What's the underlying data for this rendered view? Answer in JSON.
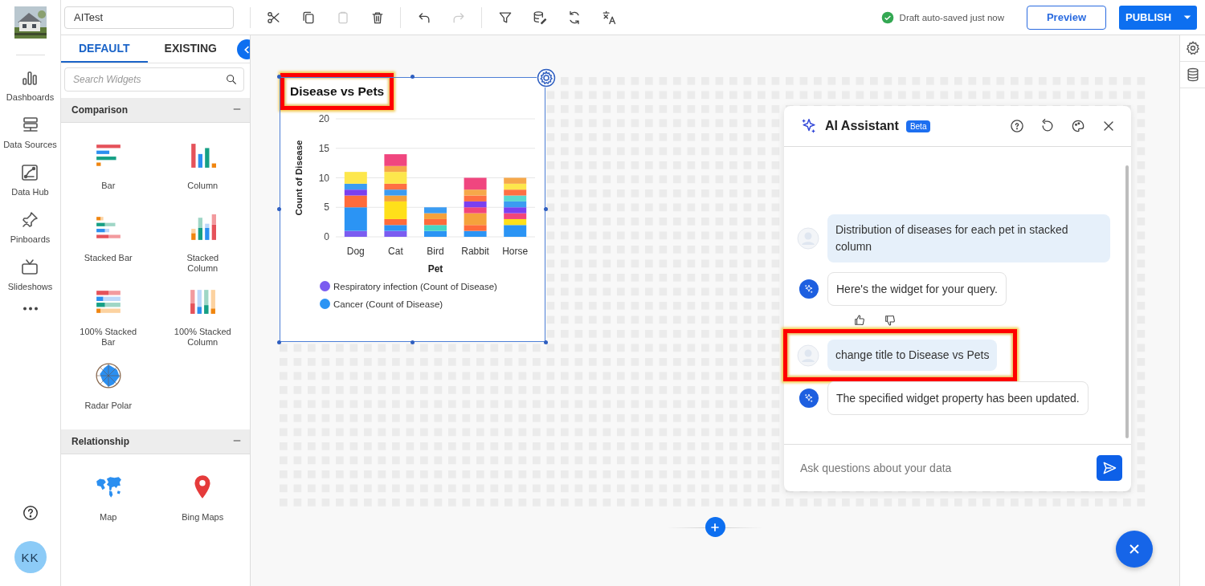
{
  "nav": {
    "items": [
      {
        "label": "Dashboards",
        "kind": "dashboards"
      },
      {
        "label": "Data Sources",
        "kind": "sources"
      },
      {
        "label": "Data Hub",
        "kind": "hub"
      },
      {
        "label": "Pinboards",
        "kind": "pin"
      },
      {
        "label": "Slideshows",
        "kind": "slides"
      },
      {
        "kind": "more"
      }
    ],
    "user": {
      "initials": "KK"
    }
  },
  "toolbar": {
    "title_field": {
      "value": "AITest"
    },
    "tools": [
      {
        "kind": "cut",
        "disabled": false
      },
      {
        "kind": "copy",
        "disabled": false
      },
      {
        "kind": "paste",
        "disabled": true
      },
      {
        "kind": "delete",
        "disabled": false
      },
      {
        "kind": "undo",
        "disabled": false
      },
      {
        "kind": "redo",
        "disabled": true
      },
      {
        "kind": "filter",
        "disabled": false
      },
      {
        "kind": "dataedit",
        "disabled": false
      },
      {
        "kind": "refresh",
        "disabled": false
      },
      {
        "kind": "translate",
        "disabled": false
      }
    ],
    "status": "Draft auto-saved just now",
    "preview": "Preview",
    "publish": "PUBLISH"
  },
  "widget_panel": {
    "tabs": [
      {
        "label": "DEFAULT",
        "selected": true
      },
      {
        "label": "EXISTING",
        "selected": false
      }
    ],
    "search": {
      "placeholder": "Search Widgets"
    },
    "groups": [
      {
        "title": "Comparison",
        "expanded": true,
        "items": [
          {
            "label": "Bar",
            "kind": "bar"
          },
          {
            "label": "Column",
            "kind": "column"
          },
          {
            "label": "Stacked Bar",
            "kind": "stackedbar"
          },
          {
            "label": "Stacked Column",
            "kind": "stackedcolumn"
          },
          {
            "label": "100% Stacked Bar",
            "kind": "bar100"
          },
          {
            "label": "100% Stacked Column",
            "kind": "column100"
          },
          {
            "label": "Radar Polar",
            "kind": "radar"
          }
        ]
      },
      {
        "title": "Relationship",
        "expanded": true,
        "items": [
          {
            "label": "Map",
            "kind": "map"
          },
          {
            "label": "Bing Maps",
            "kind": "pinmap"
          }
        ]
      }
    ]
  },
  "widget": {
    "title": "Disease vs Pets",
    "title_highlighted": true,
    "selected": true,
    "chart_data": {
      "type": "bar",
      "stacked": true,
      "grid": true,
      "xlabel": "Pet",
      "ylabel": "Count of Disease",
      "categories": [
        "Dog",
        "Cat",
        "Bird",
        "Rabbit",
        "Horse"
      ],
      "yticks": [
        0,
        5,
        10,
        15,
        20
      ],
      "ylim": [
        0,
        20
      ],
      "series": [
        {
          "name": "Respiratory infection (Count of Disease)",
          "color": "#7b5cf0",
          "values": [
            1,
            1,
            null,
            null,
            null
          ]
        },
        {
          "name": "Cancer (Count of Disease)",
          "color": "#2b94f4",
          "values": [
            4,
            1,
            1,
            1,
            2
          ]
        },
        {
          "color": "#46d6c4",
          "values": [
            null,
            null,
            1,
            null,
            null
          ]
        },
        {
          "color": "#ff6b3b",
          "values": [
            2,
            1,
            1,
            1,
            null
          ]
        },
        {
          "color": "#ffe01a",
          "values": [
            null,
            3,
            null,
            null,
            1
          ]
        },
        {
          "color": "#f5a23c",
          "values": [
            null,
            1,
            1,
            2,
            null
          ]
        },
        {
          "color": "#f2457a",
          "values": [
            null,
            null,
            null,
            1,
            1
          ]
        },
        {
          "color": "#7b3ff0",
          "values": [
            1,
            null,
            null,
            1,
            1
          ]
        },
        {
          "color": "#3b9cf2",
          "values": [
            1,
            1,
            1,
            null,
            1
          ]
        },
        {
          "color": "#5ad9d0",
          "values": [
            null,
            null,
            null,
            null,
            1
          ]
        },
        {
          "color": "#ff7043",
          "values": [
            null,
            1,
            null,
            1,
            1
          ]
        },
        {
          "color": "#fde74c",
          "values": [
            2,
            2,
            null,
            null,
            1
          ]
        },
        {
          "color": "#f6a84a",
          "values": [
            null,
            1,
            null,
            1,
            1
          ]
        },
        {
          "color": "#f0467f",
          "values": [
            null,
            2,
            null,
            2,
            null
          ]
        }
      ]
    }
  },
  "assistant": {
    "title": "AI Assistant",
    "badge": "Beta",
    "messages": [
      {
        "kind": "user",
        "text": "Distribution of diseases for each pet in stacked column",
        "highlighted": false,
        "feedback": false
      },
      {
        "kind": "assistant",
        "text": "Here's the widget for your query.",
        "highlighted": false,
        "feedback": true
      },
      {
        "kind": "user",
        "text": "change title to Disease vs Pets",
        "highlighted": true,
        "feedback": false
      },
      {
        "kind": "assistant",
        "text": "The specified widget property has been updated.",
        "highlighted": false,
        "feedback": false
      }
    ],
    "input": {
      "placeholder": "Ask questions about your data"
    }
  }
}
